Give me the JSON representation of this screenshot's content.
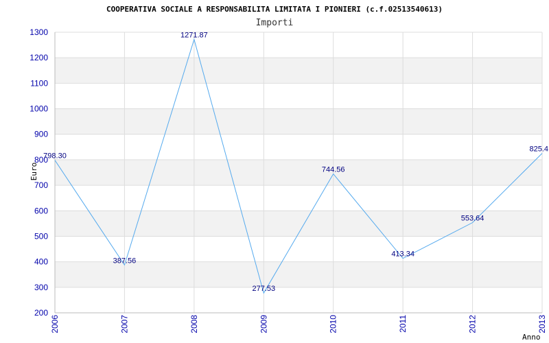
{
  "colors": {
    "axis_text": "#0000aa",
    "data_label": "#000080",
    "series_line": "#55aaee",
    "band_fill": "#f2f2f2",
    "grid_line": "#dddddd",
    "axis_line": "#bbbbbb"
  },
  "chart_data": {
    "type": "line",
    "title": "COOPERATIVA SOCIALE A RESPONSABILITA LIMITATA I PIONIERI (c.f.02513540613)",
    "subtitle": "Importi",
    "xlabel": "Anno",
    "ylabel": "Euro",
    "ylim": [
      200,
      1300
    ],
    "yticks": [
      200,
      300,
      400,
      500,
      600,
      700,
      800,
      900,
      1000,
      1100,
      1200,
      1300
    ],
    "grid": true,
    "legend": "none",
    "categories": [
      "2006",
      "2007",
      "2008",
      "2009",
      "2010",
      "2011",
      "2012",
      "2013"
    ],
    "series": [
      {
        "values": [
          798.3,
          387.56,
          1271.87,
          277.53,
          744.56,
          413.34,
          553.64,
          825.4
        ],
        "labels": [
          "798.30",
          "387.56",
          "1271.87",
          "277.53",
          "744.56",
          "413.34",
          "553.64",
          "825.4"
        ]
      }
    ]
  }
}
